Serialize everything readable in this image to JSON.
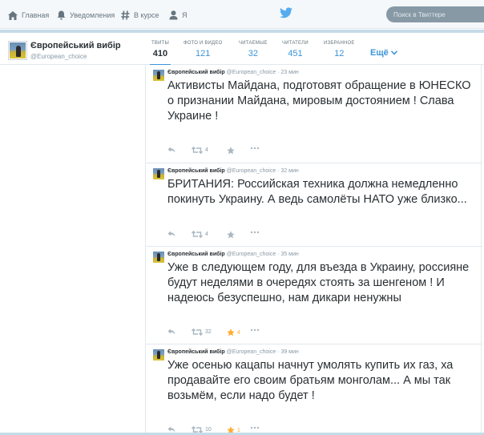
{
  "nav": {
    "home": "Главная",
    "notifications": "Уведомления",
    "discover": "В курсе",
    "me": "Я",
    "search_placeholder": "Поиск в Твиттере"
  },
  "profile": {
    "name": "Європейський вибір",
    "handle": "@European_choice",
    "stats": [
      {
        "label": "ТВИТЫ",
        "value": "410"
      },
      {
        "label": "ФОТО И ВИДЕО",
        "value": "121"
      },
      {
        "label": "ЧИТАЕМЫЕ",
        "value": "32"
      },
      {
        "label": "ЧИТАТЕЛИ",
        "value": "451"
      },
      {
        "label": "ИЗБРАННОЕ",
        "value": "12"
      }
    ],
    "more": "Ещё"
  },
  "tweets": [
    {
      "name": "Європейський вибір",
      "handle": "@European_choice",
      "time": "· 23 мин",
      "text": "Активисты Майдана, подготовят обращение в ЮНЕСКО о признании Майдана, мировым достоянием ! Слава Украине !",
      "retweets": "4",
      "favorites": ""
    },
    {
      "name": "Європейський вибір",
      "handle": "@European_choice",
      "time": "· 32 мин",
      "text": "БРИТАНИЯ: Российская техника должна немедленно покинуть Украину. А ведь самолёты НАТО уже близко...",
      "retweets": "4",
      "favorites": ""
    },
    {
      "name": "Європейський вибір",
      "handle": "@European_choice",
      "time": "· 35 мин",
      "text": "Уже в следующем году, для въезда в Украину, россияне будут неделями в очередях стоять за шенгеном ! И надеюсь безуспешно, нам дикари ненужны",
      "retweets": "32",
      "favorites": "4"
    },
    {
      "name": "Європейський вибір",
      "handle": "@European_choice",
      "time": "· 39 мин",
      "text": "Уже осенью кацапы начнут умолять купить их газ, ха продавайте его своим братьям монголам... А мы так возьмём, если надо будет !",
      "retweets": "10",
      "favorites": "1"
    }
  ],
  "colors": {
    "accent": "#3b94d9",
    "favorite": "#ffac33",
    "muted": "#8899a6"
  }
}
